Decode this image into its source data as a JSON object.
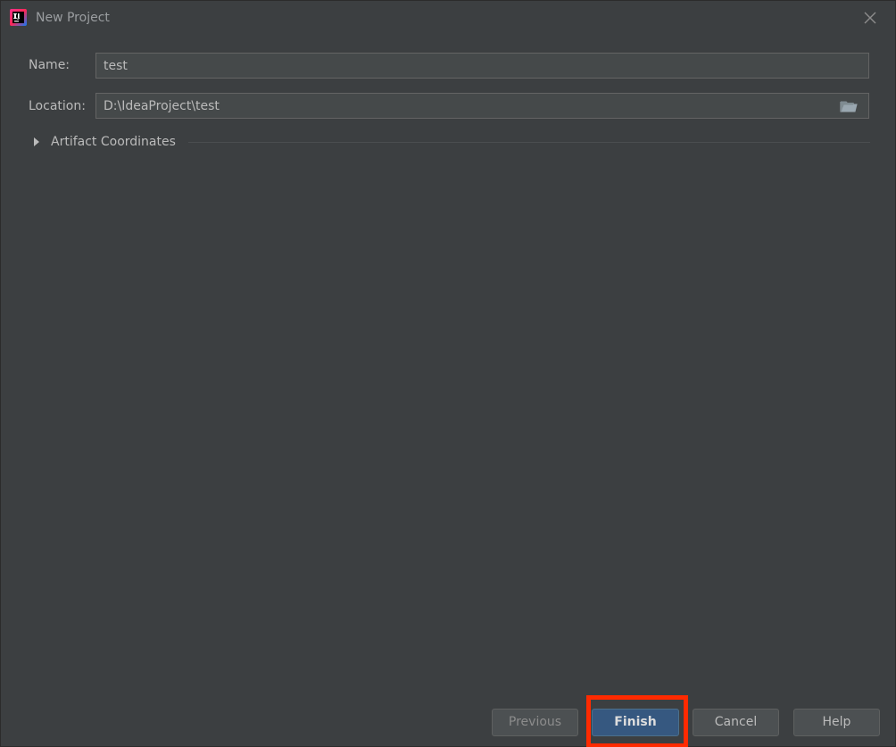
{
  "window": {
    "title": "New Project",
    "icon": "intellij-idea-icon"
  },
  "form": {
    "name_label": "Name:",
    "name_value": "test",
    "location_label": "Location:",
    "location_value": "D:\\IdeaProject\\test",
    "browse_icon": "folder-icon"
  },
  "section": {
    "label": "Artifact Coordinates",
    "expanded": false
  },
  "buttons": {
    "previous": "Previous",
    "finish": "Finish",
    "cancel": "Cancel",
    "help": "Help"
  },
  "colors": {
    "background": "#3c3f41",
    "field_background": "#45494a",
    "primary_button": "#365880",
    "highlight": "#ff2a00"
  }
}
